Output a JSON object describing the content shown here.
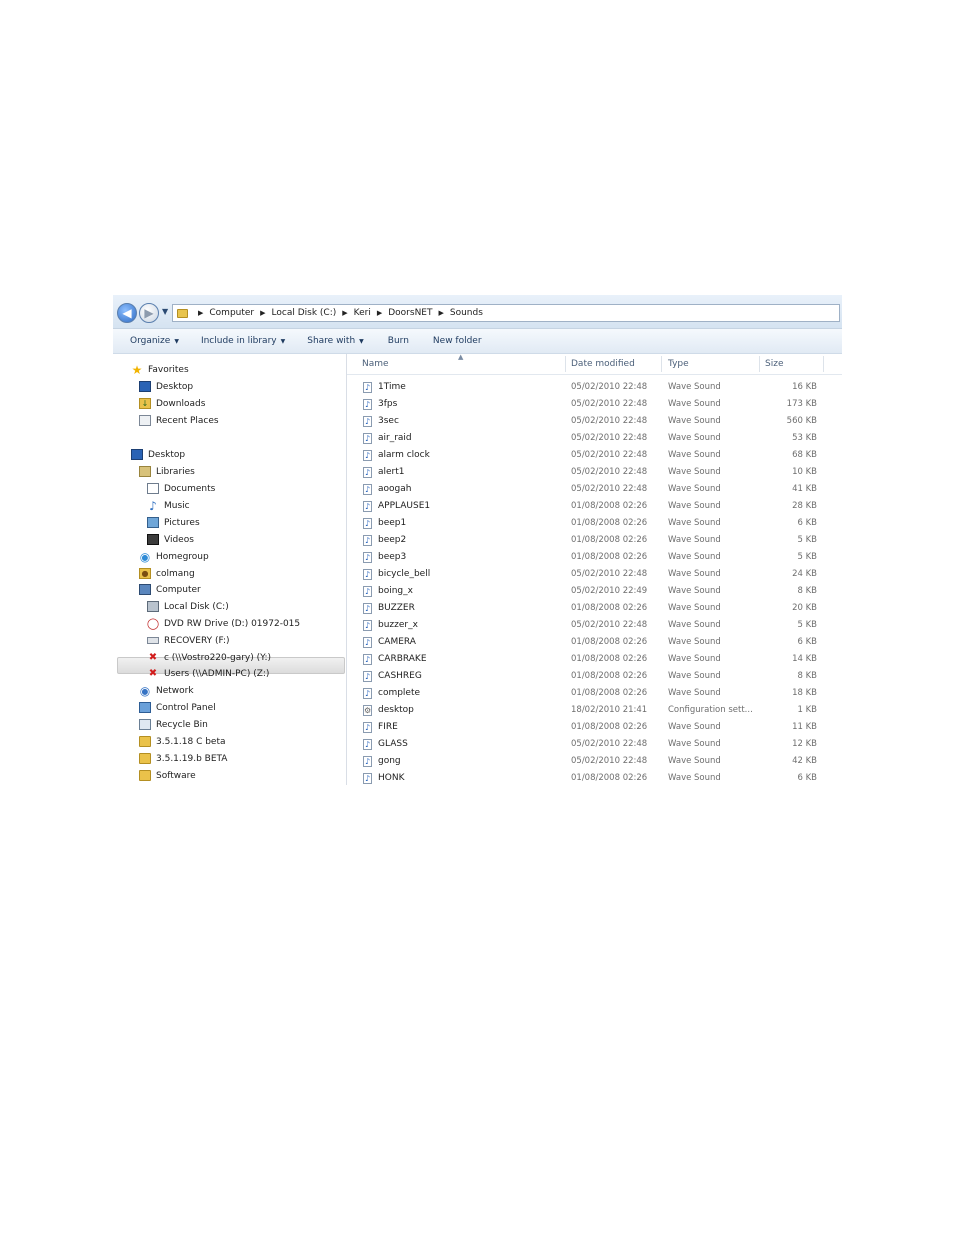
{
  "address": {
    "crumbs": [
      "Computer",
      "Local Disk (C:)",
      "Keri",
      "DoorsNET",
      "Sounds"
    ]
  },
  "toolbar": {
    "organize": "Organize",
    "include_in_library": "Include in library",
    "share_with": "Share with",
    "burn": "Burn",
    "new_folder": "New folder"
  },
  "nav": {
    "favorites": "Favorites",
    "fav_desktop": "Desktop",
    "downloads": "Downloads",
    "recent_places": "Recent Places",
    "desktop": "Desktop",
    "libraries": "Libraries",
    "documents": "Documents",
    "music": "Music",
    "pictures": "Pictures",
    "videos": "Videos",
    "homegroup": "Homegroup",
    "user": "colmang",
    "computer": "Computer",
    "local_disk": "Local Disk (C:)",
    "dvd": "DVD RW Drive (D:) 01972-015",
    "recovery": "RECOVERY (F:)",
    "net_y": "c (\\\\Vostro220-gary) (Y:)",
    "net_z": "Users (\\\\ADMIN-PC) (Z:)",
    "network": "Network",
    "control_panel": "Control Panel",
    "recycle_bin": "Recycle Bin",
    "folder_1": "3.5.1.18 C beta",
    "folder_2": "3.5.1.19.b BETA",
    "folder_3": "Software"
  },
  "columns": {
    "name": "Name",
    "date": "Date modified",
    "type": "Type",
    "size": "Size"
  },
  "files": [
    {
      "name": "1Time",
      "date": "05/02/2010 22:48",
      "type": "Wave Sound",
      "size": "16 KB"
    },
    {
      "name": "3fps",
      "date": "05/02/2010 22:48",
      "type": "Wave Sound",
      "size": "173 KB"
    },
    {
      "name": "3sec",
      "date": "05/02/2010 22:48",
      "type": "Wave Sound",
      "size": "560 KB"
    },
    {
      "name": "air_raid",
      "date": "05/02/2010 22:48",
      "type": "Wave Sound",
      "size": "53 KB"
    },
    {
      "name": "alarm clock",
      "date": "05/02/2010 22:48",
      "type": "Wave Sound",
      "size": "68 KB"
    },
    {
      "name": "alert1",
      "date": "05/02/2010 22:48",
      "type": "Wave Sound",
      "size": "10 KB"
    },
    {
      "name": "aoogah",
      "date": "05/02/2010 22:48",
      "type": "Wave Sound",
      "size": "41 KB"
    },
    {
      "name": "APPLAUSE1",
      "date": "01/08/2008 02:26",
      "type": "Wave Sound",
      "size": "28 KB"
    },
    {
      "name": "beep1",
      "date": "01/08/2008 02:26",
      "type": "Wave Sound",
      "size": "6 KB"
    },
    {
      "name": "beep2",
      "date": "01/08/2008 02:26",
      "type": "Wave Sound",
      "size": "5 KB"
    },
    {
      "name": "beep3",
      "date": "01/08/2008 02:26",
      "type": "Wave Sound",
      "size": "5 KB"
    },
    {
      "name": "bicycle_bell",
      "date": "05/02/2010 22:48",
      "type": "Wave Sound",
      "size": "24 KB"
    },
    {
      "name": "boing_x",
      "date": "05/02/2010 22:49",
      "type": "Wave Sound",
      "size": "8 KB"
    },
    {
      "name": "BUZZER",
      "date": "01/08/2008 02:26",
      "type": "Wave Sound",
      "size": "20 KB"
    },
    {
      "name": "buzzer_x",
      "date": "05/02/2010 22:48",
      "type": "Wave Sound",
      "size": "5 KB"
    },
    {
      "name": "CAMERA",
      "date": "01/08/2008 02:26",
      "type": "Wave Sound",
      "size": "6 KB"
    },
    {
      "name": "CARBRAKE",
      "date": "01/08/2008 02:26",
      "type": "Wave Sound",
      "size": "14 KB"
    },
    {
      "name": "CASHREG",
      "date": "01/08/2008 02:26",
      "type": "Wave Sound",
      "size": "8 KB"
    },
    {
      "name": "complete",
      "date": "01/08/2008 02:26",
      "type": "Wave Sound",
      "size": "18 KB"
    },
    {
      "name": "desktop",
      "date": "18/02/2010 21:41",
      "type": "Configuration sett...",
      "size": "1 KB"
    },
    {
      "name": "FIRE",
      "date": "01/08/2008 02:26",
      "type": "Wave Sound",
      "size": "11 KB"
    },
    {
      "name": "GLASS",
      "date": "05/02/2010 22:48",
      "type": "Wave Sound",
      "size": "12 KB"
    },
    {
      "name": "gong",
      "date": "05/02/2010 22:48",
      "type": "Wave Sound",
      "size": "42 KB"
    },
    {
      "name": "HONK",
      "date": "01/08/2008 02:26",
      "type": "Wave Sound",
      "size": "6 KB"
    }
  ]
}
